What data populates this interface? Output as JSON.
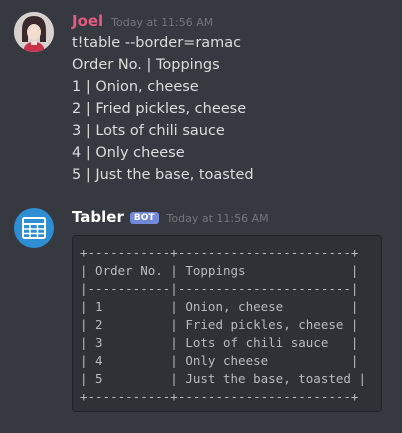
{
  "messages": [
    {
      "author": "Joel",
      "timestamp": "Today at 11:56 AM",
      "lines": [
        "t!table --border=ramac",
        "Order No. | Toppings",
        "1 | Onion, cheese",
        "2 | Fried pickles, cheese",
        "3 | Lots of chili sauce",
        "4 | Only cheese",
        "5 | Just the base, toasted"
      ]
    },
    {
      "author": "Tabler",
      "bot_tag": "BOT",
      "timestamp": "Today at 11:56 AM",
      "code_lines": [
        "+-----------+-----------------------+",
        "| Order No. | Toppings              |",
        "|-----------|-----------------------|",
        "| 1         | Onion, cheese         |",
        "| 2         | Fried pickles, cheese |",
        "| 3         | Lots of chili sauce   |",
        "| 4         | Only cheese           |",
        "| 5         | Just the base, toasted |",
        "+-----------+-----------------------+"
      ]
    }
  ],
  "icons": {
    "joel_avatar": "user-avatar-icon",
    "tabler_avatar": "table-grid-icon"
  },
  "colors": {
    "background": "#36393f",
    "joel_name": "#e55a80",
    "bot_tag": "#7289da",
    "tabler_avatar": "#2d8ed3",
    "codeblock_bg": "#2f3136"
  }
}
